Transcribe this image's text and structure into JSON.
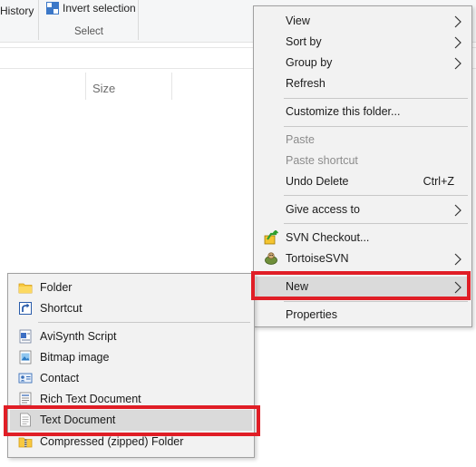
{
  "ribbon": {
    "history_label": "History",
    "invert_selection_label": "Invert selection",
    "select_group_label": "Select"
  },
  "file_list": {
    "size_column": "Size"
  },
  "context_menu": {
    "view": "View",
    "sort_by": "Sort by",
    "group_by": "Group by",
    "refresh": "Refresh",
    "customize": "Customize this folder...",
    "paste": "Paste",
    "paste_shortcut": "Paste shortcut",
    "undo_delete": "Undo Delete",
    "undo_shortcut": "Ctrl+Z",
    "give_access": "Give access to",
    "svn_checkout": "SVN Checkout...",
    "tortoise_svn": "TortoiseSVN",
    "new": "New",
    "properties": "Properties"
  },
  "new_submenu": {
    "folder": "Folder",
    "shortcut": "Shortcut",
    "avisynth": "AviSynth Script",
    "bitmap": "Bitmap image",
    "contact": "Contact",
    "rich_text": "Rich Text Document",
    "text_document": "Text Document",
    "compressed_folder": "Compressed (zipped) Folder"
  },
  "colors": {
    "menu_background": "#f2f2f2",
    "hover_background": "#dadada",
    "annotation_highlight": "#e01e26",
    "folder_yellow": "#f8c940"
  },
  "icons": {
    "invert_selection": "invert-selection-icon",
    "submenu_arrow": "chevron-right-icon",
    "svn_checkout": "svn-checkout-icon",
    "tortoise_svn": "tortoise-svn-icon",
    "folder": "folder-icon",
    "shortcut": "shortcut-arrow-icon",
    "avisynth": "avisynth-script-icon",
    "bitmap": "bitmap-image-icon",
    "contact": "contact-card-icon",
    "rich_text": "rich-text-document-icon",
    "text_document": "text-document-icon",
    "compressed_folder": "zip-folder-icon"
  }
}
